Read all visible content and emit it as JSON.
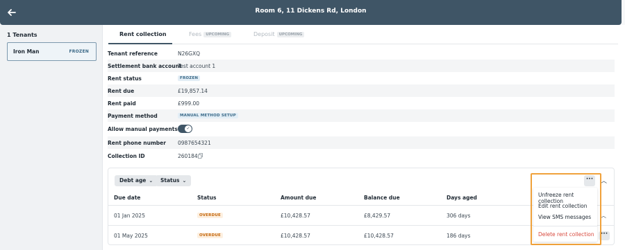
{
  "header": {
    "title": "Room 6, 11 Dickens Rd, London"
  },
  "sidebar": {
    "count_label": "1 Tenants",
    "tenants": [
      {
        "name": "Iron Man",
        "status": "FROZEN"
      }
    ]
  },
  "tabs": [
    {
      "label": "Rent collection",
      "badge": "",
      "active": true
    },
    {
      "label": "Fees",
      "badge": "UPCOMING",
      "active": false
    },
    {
      "label": "Deposit",
      "badge": "UPCOMING",
      "active": false
    }
  ],
  "details": {
    "tenant_reference": {
      "label": "Tenant reference",
      "value": "N26GXQ"
    },
    "settlement_account": {
      "label": "Settlement bank account",
      "value": "Test account 1"
    },
    "rent_status": {
      "label": "Rent status",
      "value": "FROZEN"
    },
    "rent_due": {
      "label": "Rent due",
      "value": "£19,857.14"
    },
    "rent_paid": {
      "label": "Rent paid",
      "value": "£999.00"
    },
    "payment_method": {
      "label": "Payment method",
      "value": "MANUAL METHOD SETUP"
    },
    "allow_manual": {
      "label": "Allow manual payments",
      "enabled": true
    },
    "rent_phone": {
      "label": "Rent phone number",
      "value": "0987654321"
    },
    "collection_id": {
      "label": "Collection ID",
      "value": "260184"
    }
  },
  "filters": {
    "debt_age": "Debt age",
    "status": "Status"
  },
  "table": {
    "columns": [
      "Due date",
      "Status",
      "Amount due",
      "Balance due",
      "Days aged"
    ],
    "rows": [
      {
        "due_date": "01 Jan 2025",
        "status": "OVERDUE",
        "amount_due": "£10,428.57",
        "balance_due": "£8,429.57",
        "days_aged": "306 days"
      },
      {
        "due_date": "01 May 2025",
        "status": "OVERDUE",
        "amount_due": "£10,428.57",
        "balance_due": "£10,428.57",
        "days_aged": "186 days"
      }
    ]
  },
  "menu": {
    "items": [
      "Unfreeze rent collection",
      "Edit rent collection",
      "View SMS messages"
    ],
    "danger_item": "Delete rent collection"
  },
  "colors": {
    "header": "#3f5566",
    "accent": "#3b6987",
    "overdue": "#c3660b",
    "danger": "#d84a3e",
    "highlight": "#f0a13a"
  }
}
